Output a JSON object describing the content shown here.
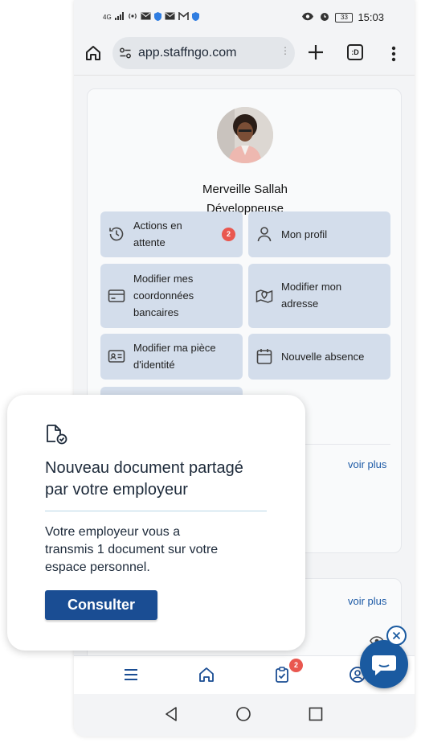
{
  "status_bar": {
    "network": "4G",
    "battery": "33",
    "time": "15:03"
  },
  "browser": {
    "url": "app.staffngo.com",
    "tabs_label": ":D"
  },
  "profile": {
    "name": "Merveille Sallah",
    "role": "Développeuse"
  },
  "actions": [
    {
      "label_lines": [
        "Actions en",
        "attente"
      ],
      "icon": "history-icon",
      "badge": "2"
    },
    {
      "label_lines": [
        "Mon profil"
      ],
      "icon": "user-icon"
    },
    {
      "label_lines": [
        "Modifier mes",
        "coordonnées",
        "bancaires"
      ],
      "icon": "credit-card-icon"
    },
    {
      "label_lines": [
        "Modifier mon",
        "adresse"
      ],
      "icon": "map-pin-icon"
    },
    {
      "label_lines": [
        "Modifier ma pièce",
        "d'identité"
      ],
      "icon": "id-card-icon"
    },
    {
      "label_lines": [
        "Nouvelle absence"
      ],
      "icon": "calendar-icon"
    }
  ],
  "links": {
    "voir_plus_1": "voir plus",
    "voir_plus_2": "voir plus"
  },
  "bottom_nav": {
    "items": [
      "menu-icon",
      "home-icon",
      "clipboard-check-icon",
      "account-icon"
    ],
    "badge": "2"
  },
  "toast": {
    "title_lines": [
      "Nouveau document partagé",
      "par votre employeur"
    ],
    "text_lines": [
      "Votre employeur vous a",
      "transmis 1 document sur votre",
      "espace personnel."
    ],
    "button": "Consulter"
  },
  "colors": {
    "accent": "#1a4d93",
    "action_bg": "#d3ddeb",
    "badge": "#e9574f",
    "link": "#1d5aa6"
  }
}
